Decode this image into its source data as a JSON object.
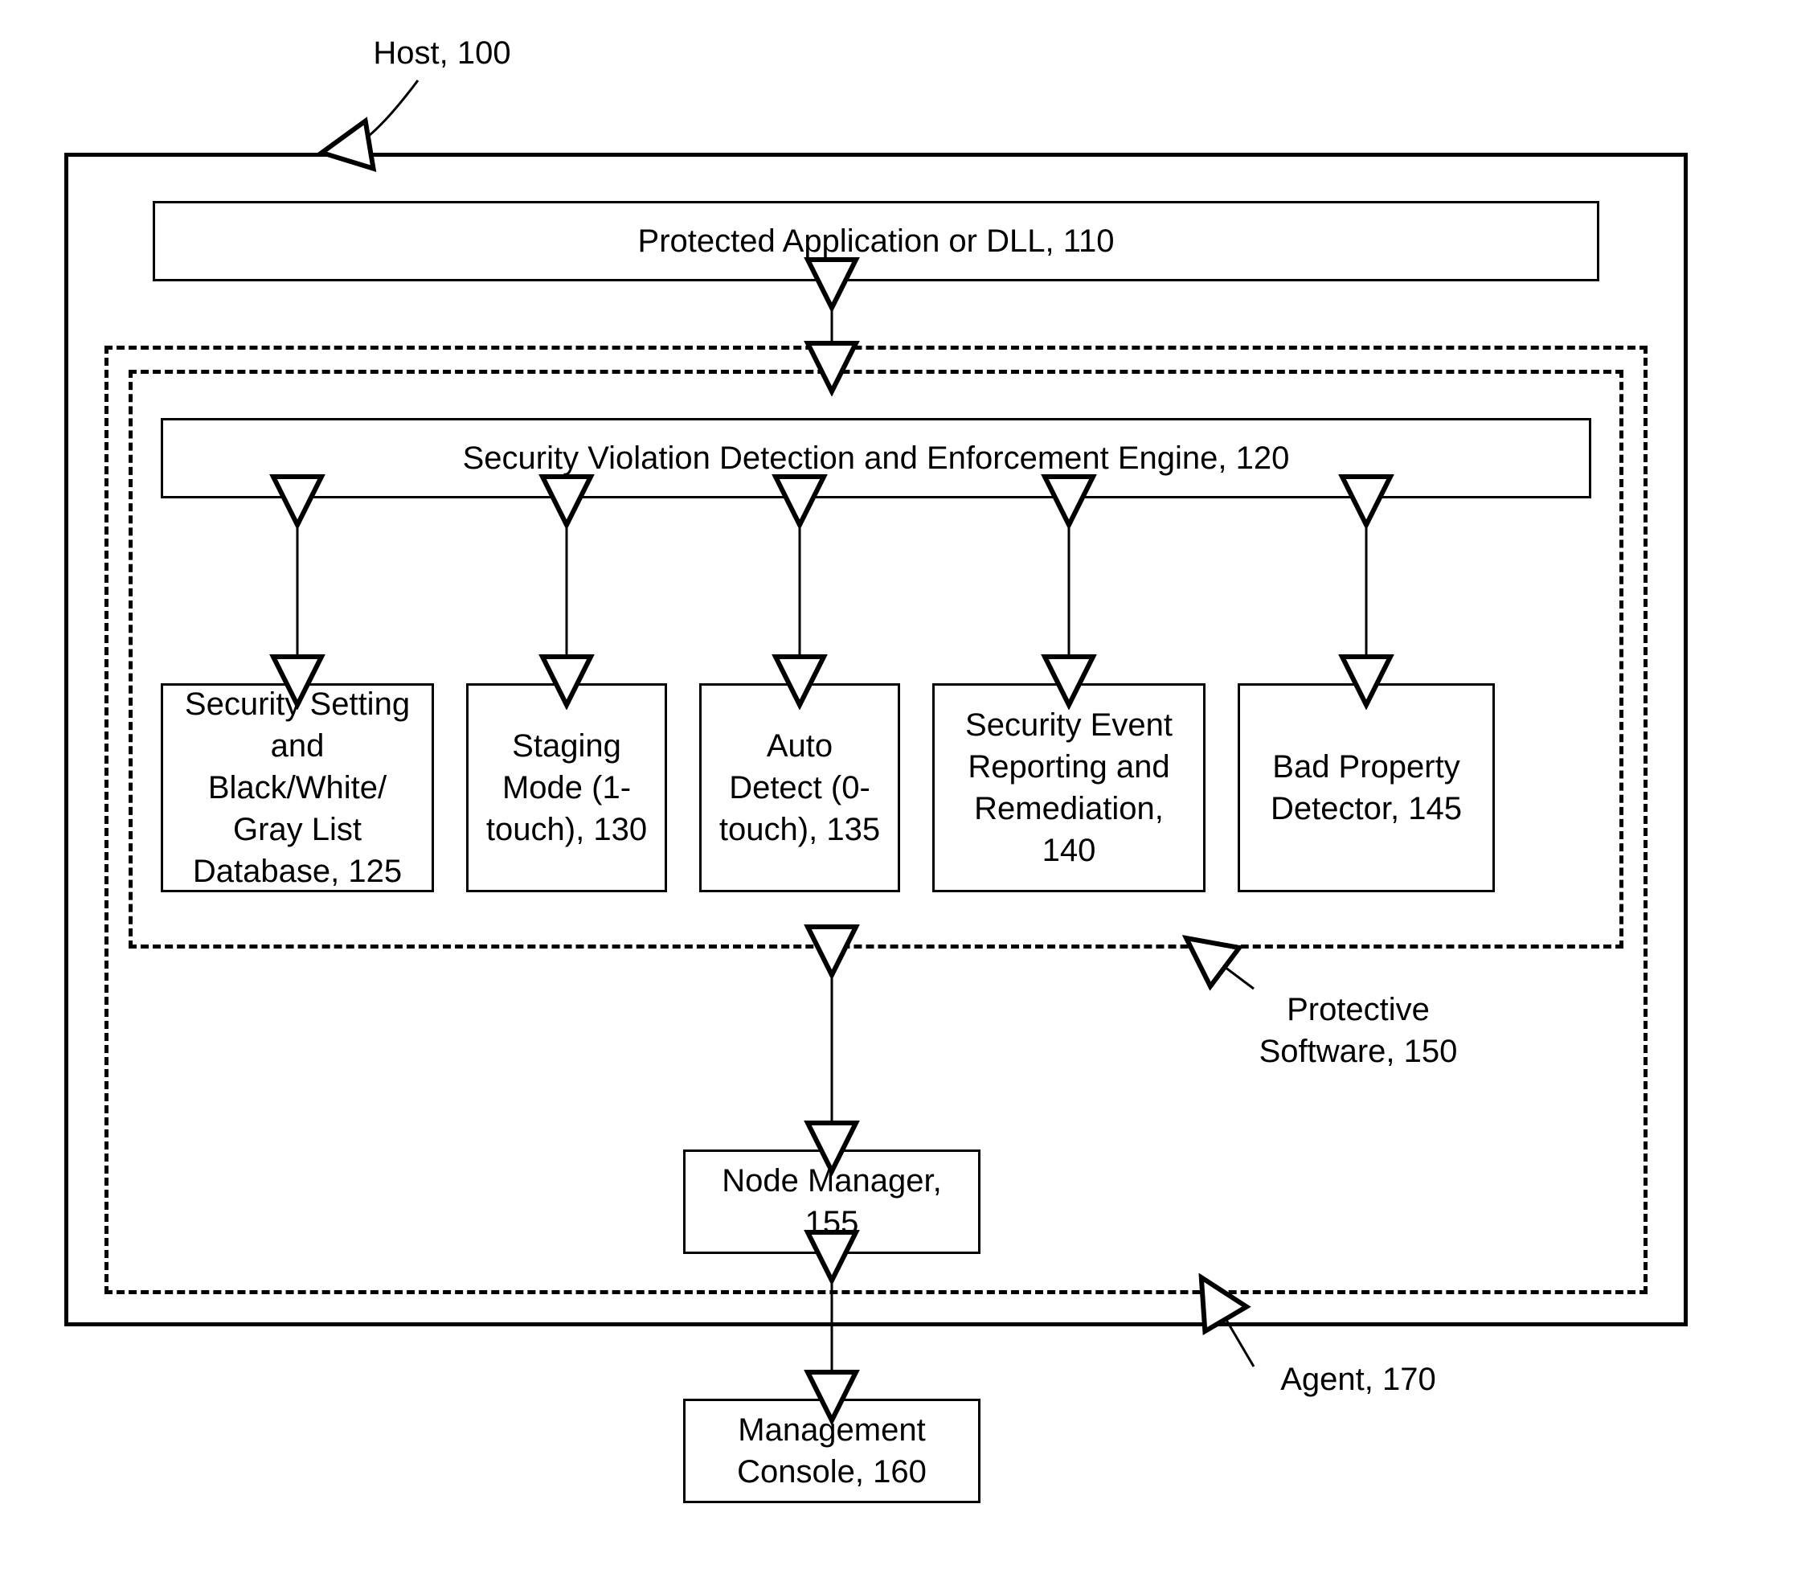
{
  "labels": {
    "host": "Host, 100",
    "agent": "Agent, 170",
    "protective_software": "Protective<br>Software, 150"
  },
  "boxes": {
    "protected_app": "Protected Application or DLL, 110",
    "engine": "Security Violation Detection and Enforcement Engine, 120",
    "db": "Security Setting and Black/White/ Gray List Database, 125",
    "staging": "Staging Mode (1-touch), 130",
    "autodetect": "Auto Detect (0-touch), 135",
    "reporting": "Security Event Reporting and Remediation, 140",
    "bad_prop": "Bad Property Detector, 145",
    "node_mgr": "Node Manager, 155",
    "mgmt_console": "Management Console, 160"
  }
}
